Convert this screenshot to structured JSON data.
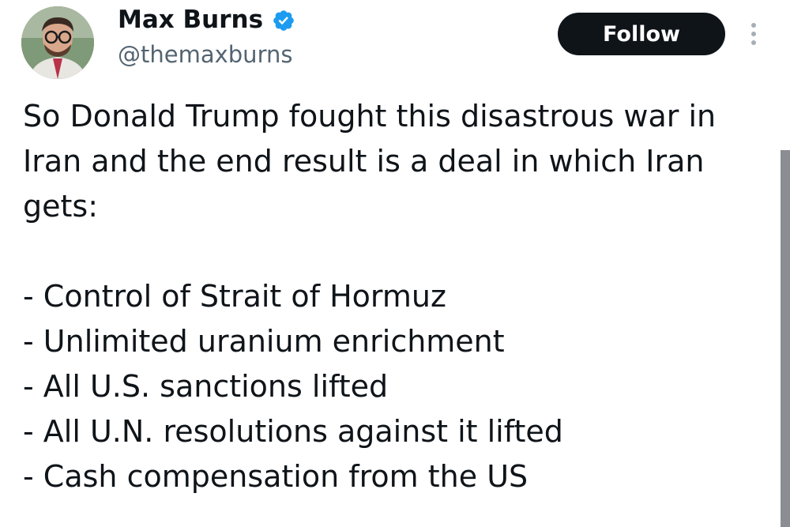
{
  "author": {
    "display_name": "Max Burns",
    "handle": "@themaxburns",
    "verified": true,
    "verified_color": "#1d9bf0"
  },
  "actions": {
    "follow_label": "Follow",
    "more_icon": "more-vertical-icon"
  },
  "tweet": {
    "paragraph_lines": [
      "So Donald Trump fought this disastrous war in",
      "Iran and the end result is a deal in which Iran",
      "gets:"
    ],
    "list_items": [
      "- Control of Strait of Hormuz",
      "- Unlimited uranium enrichment",
      "- All U.S. sanctions lifted",
      "- All U.N. resolutions against it lifted",
      "- Cash compensation from the US"
    ]
  },
  "colors": {
    "text": "#0f1419",
    "secondary_text": "#536471",
    "button_bg": "#0f1419",
    "button_text": "#ffffff"
  }
}
